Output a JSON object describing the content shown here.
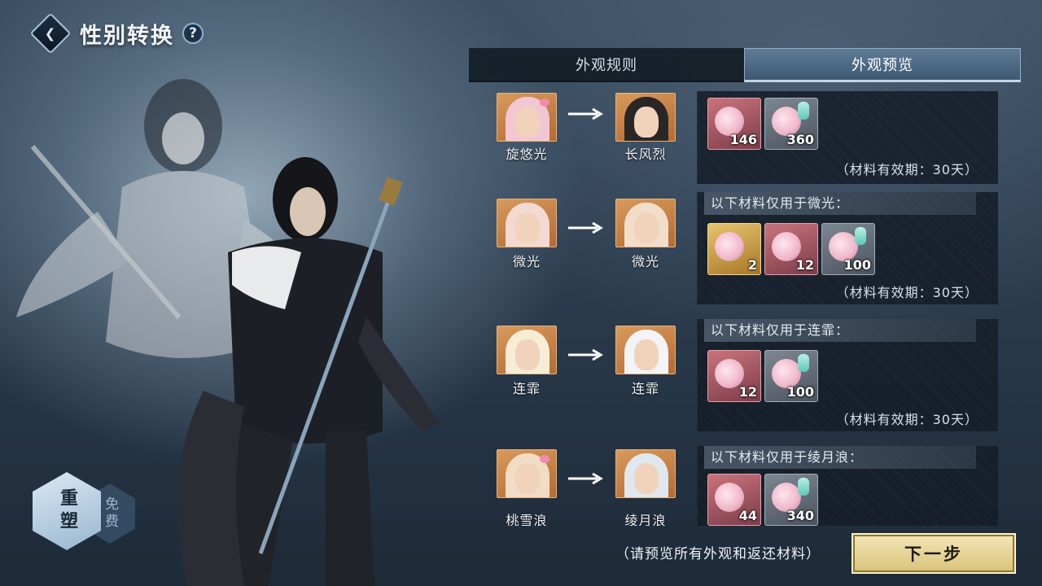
{
  "header": {
    "title": "性别转换",
    "help": "?"
  },
  "tabs": [
    {
      "label": "外观规则",
      "active": false
    },
    {
      "label": "外观预览",
      "active": true
    }
  ],
  "rows": [
    {
      "from": "旋悠光",
      "to": "长风烈",
      "materials_header": "",
      "items": [
        {
          "quantity": "146",
          "color": "pink"
        },
        {
          "quantity": "360",
          "color": "grey"
        }
      ],
      "validity": "（材料有效期：30天）"
    },
    {
      "from": "微光",
      "to": "微光",
      "materials_header": "以下材料仅用于微光：",
      "items": [
        {
          "quantity": "2",
          "color": "gold"
        },
        {
          "quantity": "12",
          "color": "pink"
        },
        {
          "quantity": "100",
          "color": "grey"
        }
      ],
      "validity": "（材料有效期：30天）"
    },
    {
      "from": "连霏",
      "to": "连霏",
      "materials_header": "以下材料仅用于连霏：",
      "items": [
        {
          "quantity": "12",
          "color": "pink"
        },
        {
          "quantity": "100",
          "color": "grey"
        }
      ],
      "validity": "（材料有效期：30天）"
    },
    {
      "from": "桃雪浪",
      "to": "绫月浪",
      "materials_header": "以下材料仅用于绫月浪：",
      "items": [
        {
          "quantity": "44",
          "color": "pink"
        },
        {
          "quantity": "340",
          "color": "grey"
        }
      ],
      "validity": ""
    }
  ],
  "reshape": {
    "main_label": "重塑",
    "sub_label": "免费"
  },
  "footer": {
    "hint": "（请预览所有外观和返还材料）",
    "next_button": "下一步"
  },
  "colors": {
    "accent_gold": "#d9c27a",
    "tab_active": "#4f6a85",
    "item_pink": "#c9737b",
    "item_grey": "#7d8792",
    "item_gold": "#e8c46d"
  }
}
